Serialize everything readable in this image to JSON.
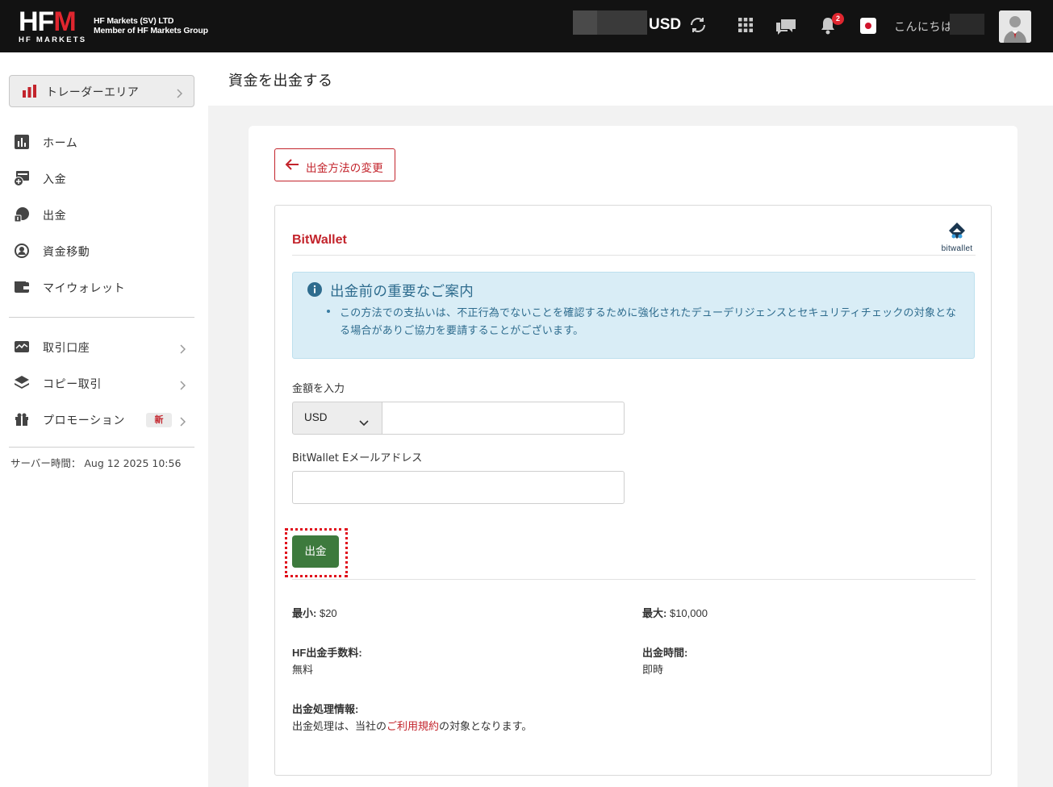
{
  "header": {
    "logo_main": "HF",
    "logo_m": "M",
    "logo_sub": "HF MARKETS",
    "company_line1": "HF Markets (SV) LTD",
    "company_line2": "Member of HF Markets Group",
    "currency": "USD",
    "notification_count": "2",
    "greeting": "こんにちは"
  },
  "sidebar": {
    "trader_area": "トレーダーエリア",
    "items": [
      {
        "label": "ホーム",
        "icon": "bar-chart-icon"
      },
      {
        "label": "入金",
        "icon": "deposit-icon"
      },
      {
        "label": "出金",
        "icon": "withdraw-icon"
      },
      {
        "label": "資金移動",
        "icon": "transfer-icon"
      },
      {
        "label": "マイウォレット",
        "icon": "wallet-icon"
      }
    ],
    "items2": [
      {
        "label": "取引口座",
        "icon": "trading-account-icon"
      },
      {
        "label": "コピー取引",
        "icon": "layers-icon"
      },
      {
        "label": "プロモーション",
        "icon": "gift-icon",
        "badge": "新"
      }
    ],
    "server_time": "サーバー時間： Aug 12 2025 10:56"
  },
  "main": {
    "page_title": "資金を出金する",
    "change_method": "出金方法の変更",
    "method_name": "BitWallet",
    "method_logo_text": "bitwallet",
    "alert_title": "出金前の重要なご案内",
    "alert_body": "この方法での支払いは、不正行為でないことを確認するために強化されたデューデリジェンスとセキュリティチェックの対象となる場合がありご協力を要請することがございます。",
    "amount_label": "金額を入力",
    "amount_currency": "USD",
    "amount_value": "",
    "email_label": "BitWallet Eメールアドレス",
    "email_value": "",
    "submit": "出金",
    "min_label": "最小:",
    "min_value": "$20",
    "max_label": "最大:",
    "max_value": "$10,000",
    "fee_label": "HF出金手数料:",
    "fee_value": "無料",
    "time_label": "出金時間:",
    "time_value": "即時",
    "process_label": "出金処理情報:",
    "process_pre": "出金処理は、当社の",
    "process_link": "ご利用規約",
    "process_post": "の対象となります。"
  },
  "colors": {
    "brand_red": "#c3242c",
    "header_bg": "#121212",
    "submit_green": "#3d7a3d",
    "alert_bg": "#d9edf6"
  }
}
